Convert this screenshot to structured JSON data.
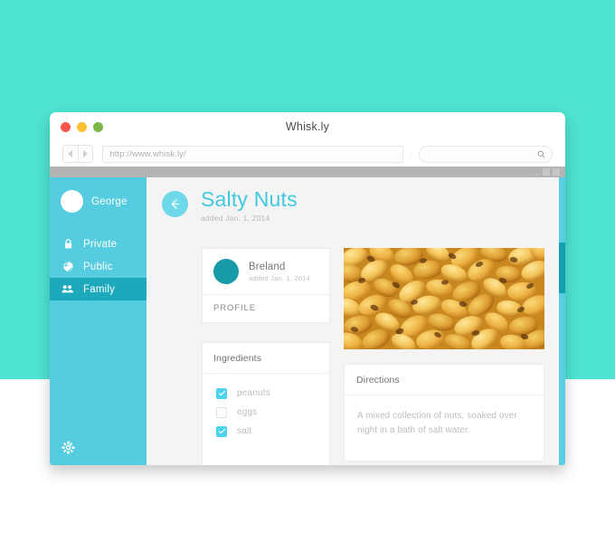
{
  "background": {
    "top_color": "#4fe3d2",
    "bottom_color": "#ffffff"
  },
  "browser": {
    "window_title": "Whisk.ly",
    "traffic_lights": [
      "close-red",
      "minimize-yellow",
      "maximize-green"
    ],
    "nav_back_icon": "triangle-left-icon",
    "nav_forward_icon": "triangle-right-icon",
    "url_value": "http://www.whisk.ly/",
    "url_placeholder": "http://www.whisk.ly/",
    "separator": "·",
    "search_placeholder": "",
    "search_icon": "magnifier-icon",
    "inner_window_controls": [
      "minimize-icon",
      "maximize-icon",
      "close-icon"
    ]
  },
  "sidebar": {
    "bg_color": "#55ccdf",
    "active_color": "#1ca9bb",
    "user": {
      "name": "George",
      "avatar_icon": "user-avatar"
    },
    "items": [
      {
        "label": "Private",
        "icon": "lock-icon",
        "active": false
      },
      {
        "label": "Public",
        "icon": "globe-icon",
        "active": false
      },
      {
        "label": "Family",
        "icon": "people-icon",
        "active": true
      }
    ],
    "settings_icon": "gear-icon"
  },
  "page": {
    "back_icon": "arrow-left-icon",
    "title": "Salty Nuts",
    "title_color": "#3fc9e0",
    "subtitle": "added Jan. 1, 2014"
  },
  "profile_card": {
    "avatar_color": "#179ba8",
    "name": "Breland",
    "date": "added Jan. 1, 2014",
    "action_label": "PROFILE"
  },
  "ingredients_card": {
    "title": "Ingredients",
    "items": [
      {
        "label": "peanuts",
        "checked": true
      },
      {
        "label": "eggs",
        "checked": false
      },
      {
        "label": "salt",
        "checked": true
      }
    ],
    "check_color": "#4fd2ec"
  },
  "recipe_image": {
    "alt": "roasted-corn-nuts-photo",
    "dominant_color": "#e0a63a"
  },
  "directions_card": {
    "title": "Directions",
    "body": "A mixed collection of nuts, soaked over night in a bath of salt water."
  },
  "scrollbar": {
    "track_color": "#5bcde2",
    "thumb_color": "#149eb2"
  }
}
